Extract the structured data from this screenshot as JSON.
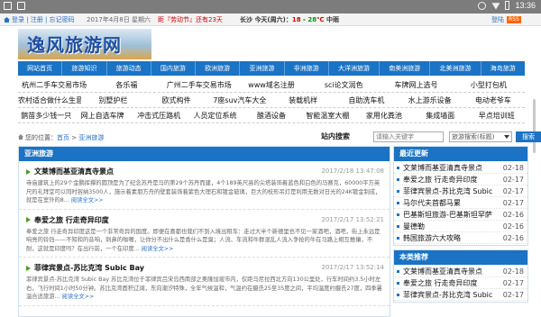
{
  "statusbar": {
    "time": "13:36"
  },
  "topbar": {
    "links": "登录 | 注册 | 忘记密码",
    "date": "2017年4月8日 星期六",
    "festival": "距『劳动节』还有23天",
    "weather_city": "长沙",
    "weather_today": "今天(周六)：",
    "weather_temp": "18",
    "weather_sep": " - ",
    "weather_low": "28",
    "weather_unit": "℃",
    "weather_cond": "中雨",
    "qiye": "企业",
    "login": "登陆",
    "rss": "RSS"
  },
  "logo": {
    "text": "逸风旅游网"
  },
  "mainnav": [
    "网站首页",
    "旅游知识",
    "旅游动态",
    "国内旅游",
    "欧洲旅游",
    "亚洲旅游",
    "非洲旅游",
    "大洋洲旅游",
    "南美洲旅游",
    "北美洲旅游",
    "海岛旅游"
  ],
  "linkgrid": [
    [
      "杭州二手车交易市场",
      "各乐福",
      "广州二手车交易市场",
      "www域名注册",
      "sci论文润色",
      "车牌网上选号",
      "小型打包机"
    ],
    [
      "农村适合做什么生意",
      "别墅护栏",
      "欧式构件",
      "7座suv汽车大全",
      "装载机样",
      "自助洗车机",
      "水上游乐设备",
      "电动老爷车"
    ],
    [
      "鹅苗多少钱一只",
      "网上自选车牌",
      "冲击式压路机",
      "人员定位系统",
      "酿酒设备",
      "智能温室大棚",
      "家用化粪池",
      "集成墙面",
      "早点培训班"
    ]
  ],
  "crumbs": {
    "prefix": "您的位置：",
    "home": "首页",
    "sep": " > ",
    "current": "亚洲旅游"
  },
  "search": {
    "label": "站内搜索",
    "placeholder": "请输入关键字",
    "select": "旅游搜索(标题)",
    "button": "搜索"
  },
  "left": {
    "title": "亚洲旅游",
    "articles": [
      {
        "title": "文莱博而基亚清真寺景点",
        "date": "2017/2/18 13:47:08",
        "body": "寺庙建筑上的29个金鹏挥撑的圆顶是为了纪念苏丹是马的第29个苏丹而建，4个189英尺高的尖塔装饰着蓝色和白色的马赛克，60000平方英尺的礼拜堂可以同时容纳3500人，施示着素朋方舟的壁套装饰着紫色大理石和镀金玻璃，巨大的枝形吊灯是利用无数对日光的24K镀金制成，就是在室外的8...",
        "more": "阅读全文>>"
      },
      {
        "title": "奉爱之旅 行走奇异印度",
        "date": "2017/2/17 13:52:21",
        "body": "奉爱之旅 行走奇异印度这是一个非常奇异的国度。即便在喜都也我们不到入境出租车：走过大半个新德里也不见一家酒吧，酒吧，街上永远是响亮的铃铛——不知和的音响，刺鼻的咖喱，让你分不出什么是香什么是臭；人流、车流和牛群混乱人流入争抢的牛在马路上相互推攘，不耐，这就是印度吗？在出行前，一个在印度...",
        "more": "阅读全文>>"
      },
      {
        "title": "菲律宾景点-苏比克湾 Subic Bay",
        "date": "2017/2/17 13:52:14",
        "body": "菲律宾景点-苏比克湾 Subic Bay 苏比克湾位于菲律宾吕宋岛西南部之奥隆加坡市内，仅距马尼拉西北方向130公里处，行车时间约3.5小时左右，飞行时间1小时50分钟。苏比克湾面积辽阔，东向潮汐特殊，全年气候温和，气温约在摄氏25至35度之间，平均温度约摄氏27度，四季暑温合适旅游...",
        "more": "阅读全文>>"
      }
    ]
  },
  "right": {
    "latest_title": "最近更新",
    "latest": [
      {
        "label": "文莱博而基亚清真寺景点",
        "date": "02-18"
      },
      {
        "label": "奉爱之旅 行走奇异印度",
        "date": "02-17"
      },
      {
        "label": "菲律宾景点-苏比克湾 Subic",
        "date": "02-17"
      },
      {
        "label": "马尔代夫首都马累",
        "date": "02-17"
      },
      {
        "label": "巴基斯坦旅游-巴基斯坦罕萨",
        "date": "02-16"
      },
      {
        "label": "曼德勒",
        "date": "02-16"
      },
      {
        "label": "韩国旅游六大攻略",
        "date": "02-16"
      }
    ],
    "recommend_title": "本类推荐",
    "recommend": [
      {
        "label": "文莱博而基亚清真寺景点",
        "date": "02-18"
      },
      {
        "label": "奉爱之旅 行走奇异印度",
        "date": "02-17"
      },
      {
        "label": "菲律宾景点-苏比克湾 Subic",
        "date": "02-17"
      }
    ]
  }
}
